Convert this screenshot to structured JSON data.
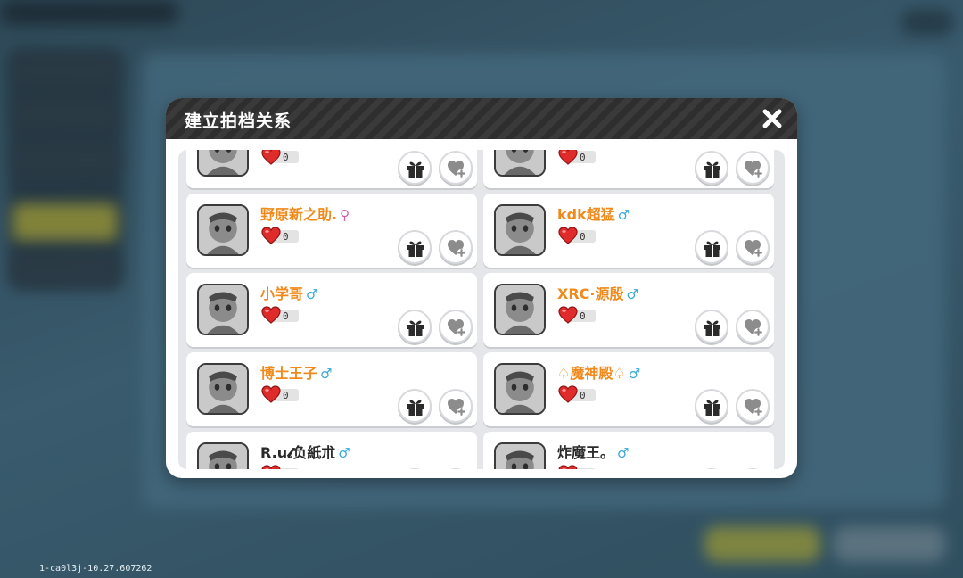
{
  "dialog": {
    "title": "建立拍档关系"
  },
  "version_text": "1-ca0l3j-10.27.607262",
  "partners": [
    {
      "name": "",
      "gender": "",
      "hearts": "0"
    },
    {
      "name": "",
      "gender": "",
      "hearts": "0"
    },
    {
      "name": "野原新之助.",
      "gender": "♀",
      "hearts": "0"
    },
    {
      "name": "kdk超猛",
      "gender": "♂",
      "hearts": "0"
    },
    {
      "name": "小学哥",
      "gender": "♂",
      "hearts": "0"
    },
    {
      "name": "XRC·源殷",
      "gender": "♂",
      "hearts": "0"
    },
    {
      "name": "博士王子",
      "gender": "♂",
      "hearts": "0"
    },
    {
      "name": "♤魔神殿♤",
      "gender": "♂",
      "hearts": "0"
    },
    {
      "name": "R.u𝓵负紙朮",
      "gender": "♂",
      "hearts": ""
    },
    {
      "name": "炸魔王。",
      "gender": "♂",
      "hearts": ""
    }
  ],
  "icons": {
    "close": "close-icon",
    "gift": "gift-icon",
    "add_favor": "heart-plus-icon",
    "heart": "heart-icon",
    "male": "male-icon",
    "female": "female-icon"
  },
  "colors": {
    "name_orange": "#f08a1c",
    "male_blue": "#3aa8d8",
    "female_pink": "#d45aa8",
    "heart_red": "#e02b2b"
  }
}
